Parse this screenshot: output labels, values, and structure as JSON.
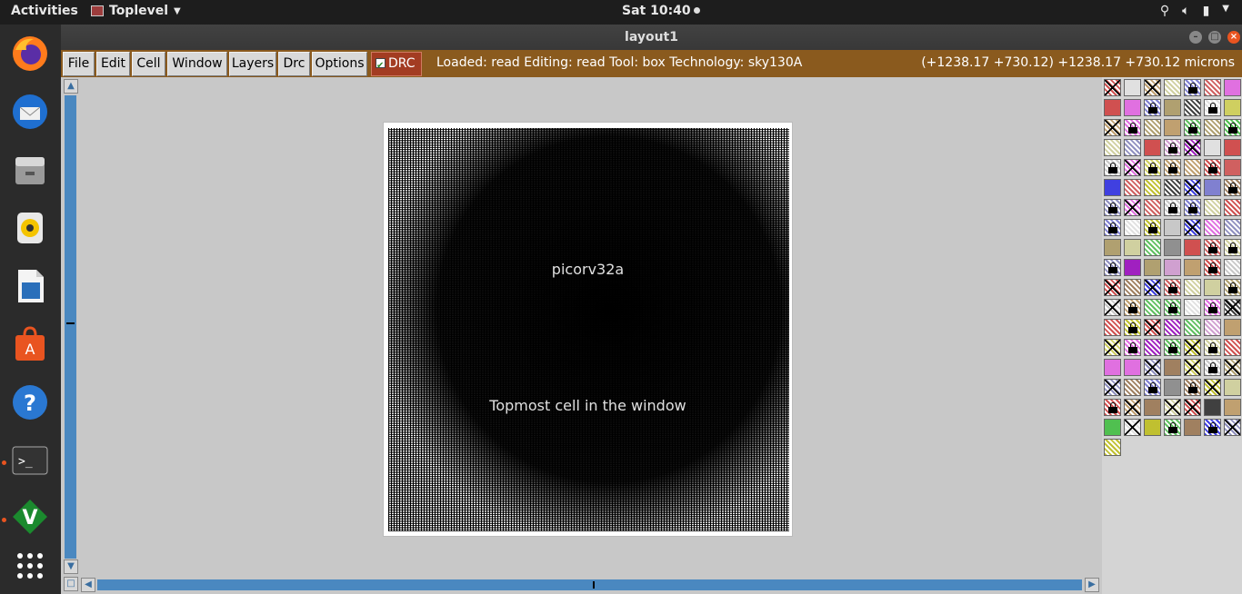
{
  "topbar": {
    "activities": "Activities",
    "app_name": "Toplevel",
    "clock": "Sat 10:40"
  },
  "dock": {
    "items": [
      "firefox-icon",
      "thunderbird-icon",
      "files-icon",
      "rhythmbox-icon",
      "libreoffice-writer-icon",
      "software-center-icon",
      "help-icon",
      "terminal-icon",
      "vim-icon",
      "show-apps-icon"
    ]
  },
  "window": {
    "title": "layout1",
    "menus": [
      "File",
      "Edit",
      "Cell",
      "Window",
      "Layers",
      "Drc",
      "Options"
    ],
    "drc_label": "DRC",
    "status": "Loaded: read Editing: read Tool: box  Technology: sky130A",
    "coords": "(+1238.17 +730.12) +1238.17 +730.12 microns"
  },
  "canvas": {
    "cell_name": "picorv32a",
    "cell_tip": "Topmost cell in the window"
  },
  "colors": {
    "menubar": "#8a5a1e",
    "scroll": "#4a88c0",
    "drc": "#a33c22"
  }
}
